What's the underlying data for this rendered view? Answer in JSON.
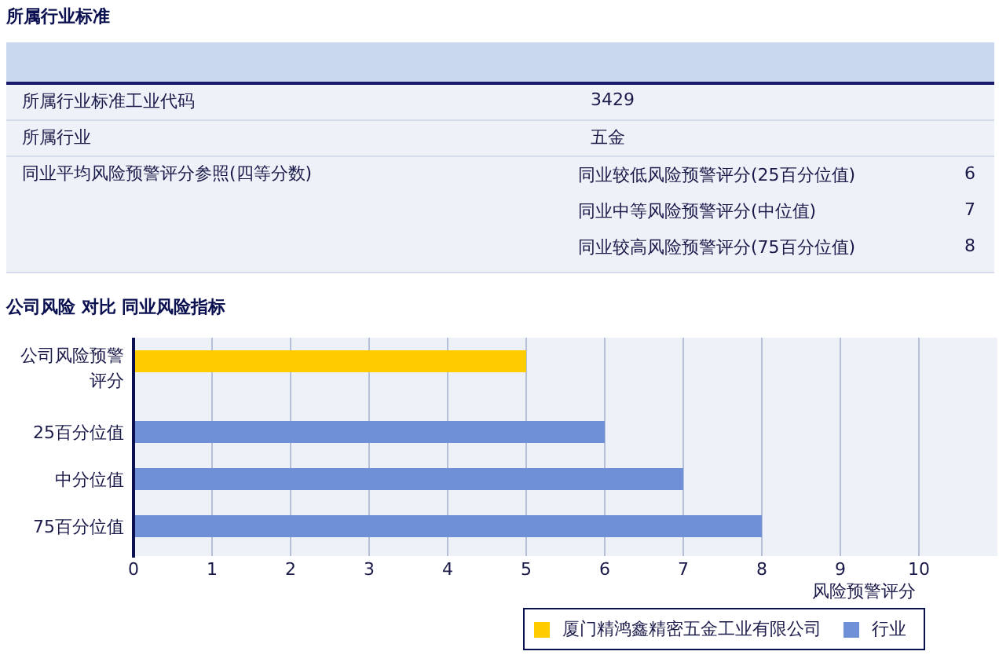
{
  "section_title": "所属行业标准",
  "table": {
    "rows": [
      {
        "label": "所属行业标准工业代码",
        "value": "3429"
      },
      {
        "label": "所属行业",
        "value": "五金"
      },
      {
        "label": "同业平均风险预警评分参照(四等分数)",
        "sub_rows": [
          {
            "label": "同业较低风险预警评分(25百分位值)",
            "value": "6"
          },
          {
            "label": "同业中等风险预警评分(中位值)",
            "value": "7"
          },
          {
            "label": "同业较高风险预警评分(75百分位值)",
            "value": "8"
          }
        ]
      }
    ]
  },
  "chart_title": "公司风险 对比 同业风险指标",
  "chart_data": {
    "type": "bar",
    "orientation": "horizontal",
    "xlabel": "风险预警评分",
    "categories": [
      [
        "公司风险预警",
        "评分"
      ],
      [
        "25百分位值"
      ],
      [
        "中分位值"
      ],
      [
        "75百分位值"
      ]
    ],
    "series": [
      {
        "name": "厦门精鸿鑫精密五金工业有限公司",
        "color": "#ffcc00",
        "values": [
          5,
          null,
          null,
          null
        ]
      },
      {
        "name": "行业",
        "color": "#6f8fd6",
        "values": [
          null,
          6,
          7,
          8
        ]
      }
    ],
    "xlim": [
      0,
      11
    ],
    "grid": true,
    "xticks": [
      0,
      1,
      2,
      3,
      4,
      5,
      6,
      7,
      8,
      9,
      10
    ]
  }
}
